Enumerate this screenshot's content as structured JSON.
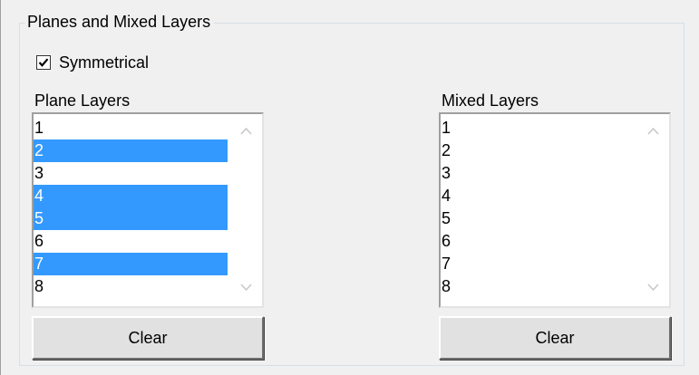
{
  "group": {
    "title": "Planes and Mixed Layers"
  },
  "symmetrical": {
    "label": "Symmetrical",
    "checked": true
  },
  "plane_layers": {
    "label": "Plane Layers",
    "items": [
      {
        "label": "1",
        "selected": false
      },
      {
        "label": "2",
        "selected": true
      },
      {
        "label": "3",
        "selected": false
      },
      {
        "label": "4",
        "selected": true
      },
      {
        "label": "5",
        "selected": true
      },
      {
        "label": "6",
        "selected": false
      },
      {
        "label": "7",
        "selected": true
      },
      {
        "label": "8",
        "selected": false
      }
    ],
    "clear_label": "Clear"
  },
  "mixed_layers": {
    "label": "Mixed Layers",
    "items": [
      {
        "label": "1",
        "selected": false
      },
      {
        "label": "2",
        "selected": false
      },
      {
        "label": "3",
        "selected": false
      },
      {
        "label": "4",
        "selected": false
      },
      {
        "label": "5",
        "selected": false
      },
      {
        "label": "6",
        "selected": false
      },
      {
        "label": "7",
        "selected": false
      },
      {
        "label": "8",
        "selected": false
      }
    ],
    "clear_label": "Clear"
  },
  "colors": {
    "selection": "#3399ff",
    "background": "#f0f0f0"
  }
}
